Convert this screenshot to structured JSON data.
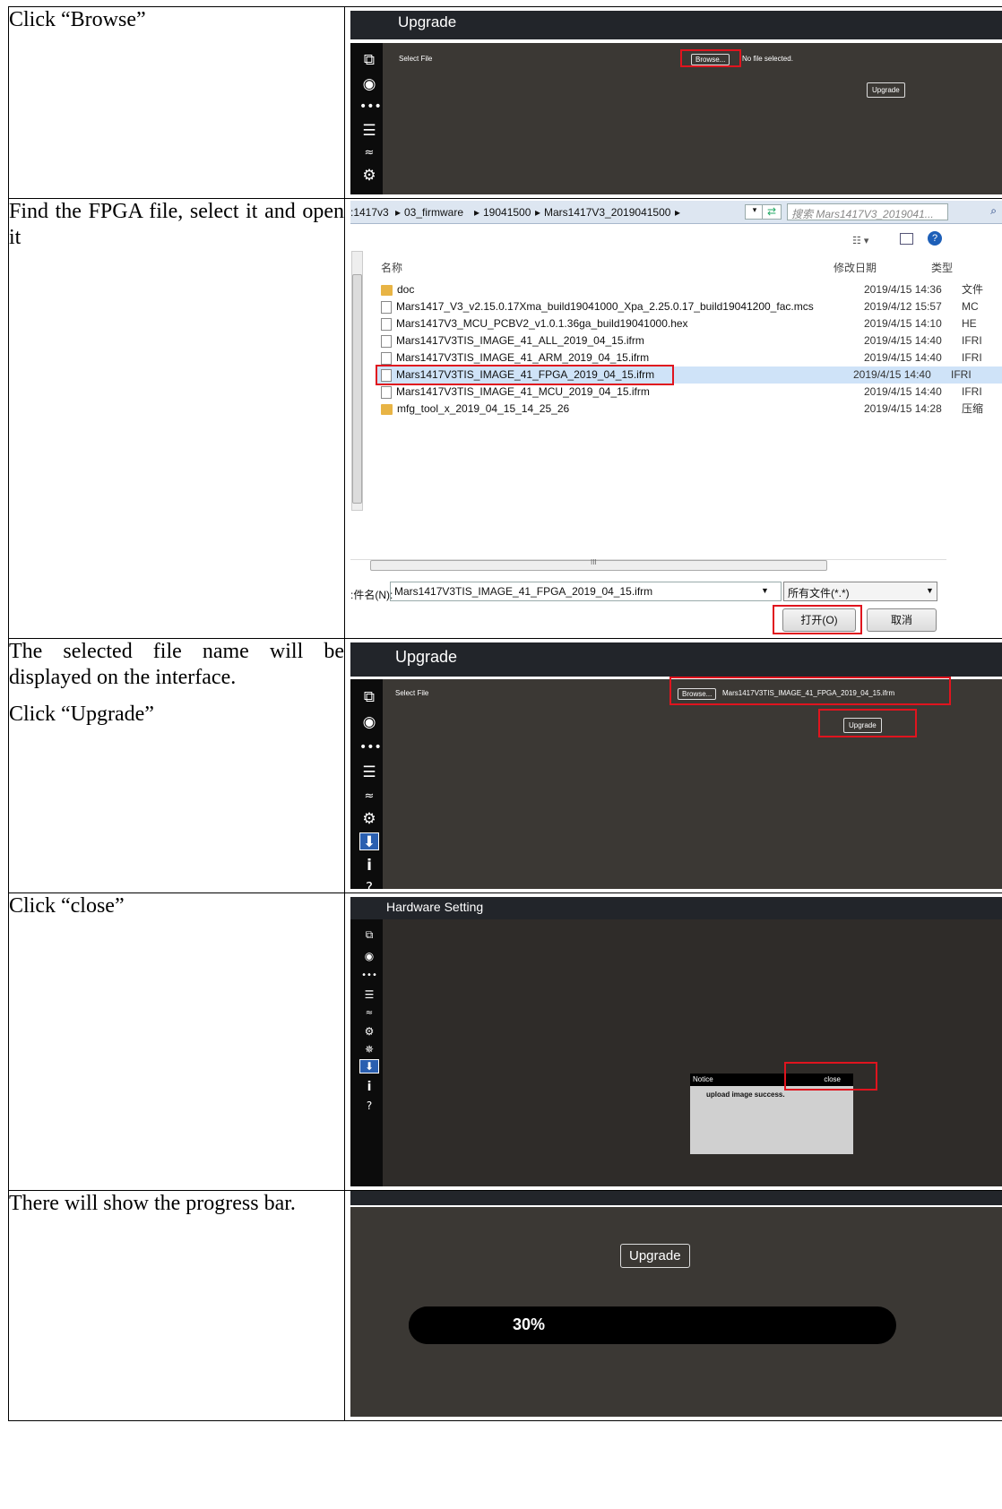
{
  "steps": [
    {
      "text": "Click “Browse”"
    },
    {
      "text": "Find the FPGA file, select it and open it"
    },
    {
      "text1": "The selected file name will be displayed on the interface.",
      "text2": "Click “Upgrade”"
    },
    {
      "text": "Click “close”"
    },
    {
      "text": "There will show the progress bar."
    }
  ],
  "upgrade_panel": {
    "title": "Upgrade",
    "select_label": "Select File",
    "browse_label": "Browse...",
    "no_file": "No file selected.",
    "upgrade_label": "Upgrade",
    "selected_file": "Mars1417V3TIS_IMAGE_41_FPGA_2019_04_15.ifrm"
  },
  "sidebar_icons": [
    "copy-icon",
    "disc-icon",
    "more-icon",
    "list-icon",
    "wifi-icon",
    "settings-icon",
    "download-icon",
    "info-icon",
    "help-icon"
  ],
  "sidebar_glyphs": {
    "info": "i",
    "help": "?"
  },
  "file_dialog": {
    "breadcrumb": [
      ":1417v3",
      "03_firmware",
      "19041500",
      "Mars1417V3_2019041500"
    ],
    "search_placeholder": "搜索 Mars1417V3_2019041...",
    "col_name": "名称",
    "col_date": "修改日期",
    "col_type": "类型",
    "files": [
      {
        "name": "doc",
        "date": "2019/4/15 14:36",
        "type": "文件",
        "kind": "folder"
      },
      {
        "name": "Mars1417_V3_v2.15.0.17Xma_build19041000_Xpa_2.25.0.17_build19041200_fac.mcs",
        "date": "2019/4/12 15:57",
        "type": "MC",
        "kind": "file"
      },
      {
        "name": "Mars1417V3_MCU_PCBV2_v1.0.1.36ga_build19041000.hex",
        "date": "2019/4/15 14:10",
        "type": "HE",
        "kind": "file"
      },
      {
        "name": "Mars1417V3TIS_IMAGE_41_ALL_2019_04_15.ifrm",
        "date": "2019/4/15 14:40",
        "type": "IFRI",
        "kind": "file"
      },
      {
        "name": "Mars1417V3TIS_IMAGE_41_ARM_2019_04_15.ifrm",
        "date": "2019/4/15 14:40",
        "type": "IFRI",
        "kind": "file"
      },
      {
        "name": "Mars1417V3TIS_IMAGE_41_FPGA_2019_04_15.ifrm",
        "date": "2019/4/15 14:40",
        "type": "IFRI",
        "kind": "file"
      },
      {
        "name": "Mars1417V3TIS_IMAGE_41_MCU_2019_04_15.ifrm",
        "date": "2019/4/15 14:40",
        "type": "IFRI",
        "kind": "file"
      },
      {
        "name": "mfg_tool_x_2019_04_15_14_25_26",
        "date": "2019/4/15 14:28",
        "type": "压缩",
        "kind": "folder"
      }
    ],
    "filename_label": ":件名(N):",
    "filename_value": "Mars1417V3TIS_IMAGE_41_FPGA_2019_04_15.ifrm",
    "filter_value": "所有文件(*.*)",
    "open_label": "打开(O)",
    "cancel_label": "取消",
    "scroll_dots": "III"
  },
  "hardware": {
    "title": "Hardware Setting",
    "notice_title": "Notice",
    "close_label": "close",
    "notice_msg": "upload image success."
  },
  "progress": {
    "upgrade_label": "Upgrade",
    "percent": 30,
    "percent_label": "30%"
  }
}
